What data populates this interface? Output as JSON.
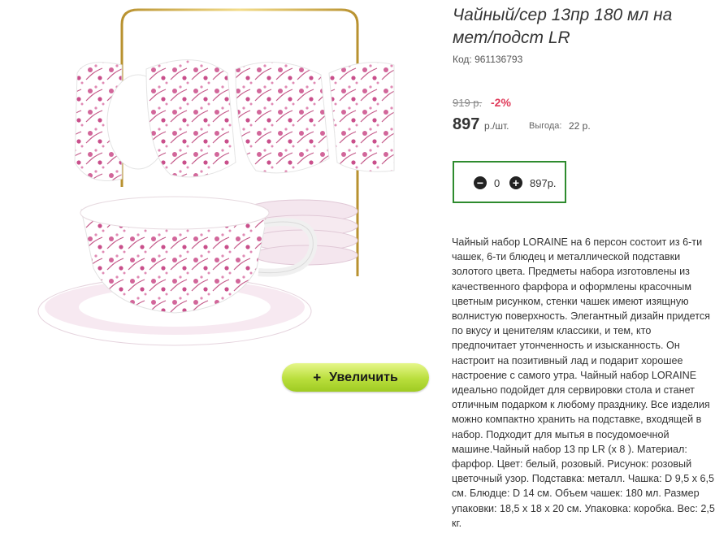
{
  "product": {
    "title": "Чайный/сер 13пр 180 мл на мет/подст LR",
    "code_label": "Код:",
    "code": "961136793",
    "code_text": "Код: 961136793",
    "old_price": "919 р.",
    "discount": "-2%",
    "price": "897",
    "price_unit": "р./шт.",
    "benefit_label": "Выгода:",
    "benefit_value": "22 р.",
    "zoom_label": "Увеличить",
    "description": "Чайный набор LORAINE на 6 персон состоит из 6-ти чашек, 6-ти блюдец и металлической подставки золотого цвета. Предметы набора изготовлены из качественного фарфора и оформлены красочным цветным рисунком, стенки чашек имеют изящную волнистую поверхность. Элегантный дизайн придется по вкусу и ценителям классики, и тем, кто предпочитает утонченность и изысканность. Он настроит на позитивный лад и подарит хорошее настроение с самого утра. Чайный набор LORAINE идеально подойдет для сервировки стола и станет отличным подарком к любому празднику. Все изделия можно компактно хранить на подставке, входящей в набор. Подходит для мытья в посудомоечной машине.Чайный набор 13 пр LR (х 8 ). Материал: фарфор. Цвет: белый, розовый. Рисунок: розовый цветочный узор. Подставка: металл. Чашка: D 9,5 х 6,5 см. Блюдце: D 14 см. Объем чашек: 180 мл. Размер упаковки: 18,5 х 18 х 20 см. Упаковка: коробка. Вес: 2,5 кг."
  },
  "cart": {
    "quantity": "0",
    "sum": "897р."
  },
  "colors": {
    "accent_pink": "#e03b5a",
    "cart_border": "#2e8b2e",
    "zoom_button": "#b9de3c"
  }
}
